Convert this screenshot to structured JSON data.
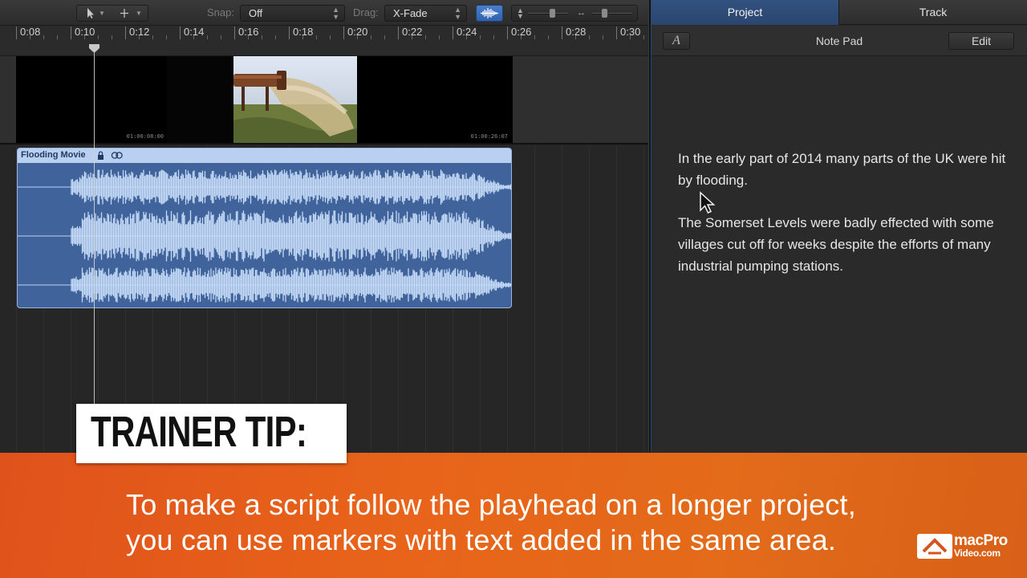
{
  "toolbar": {
    "snap_label": "Snap:",
    "snap_value": "Off",
    "drag_label": "Drag:",
    "drag_value": "X-Fade"
  },
  "ruler": {
    "ticks": [
      "0:08",
      "0:10",
      "0:12",
      "0:14",
      "0:16",
      "0:18",
      "0:20",
      "0:22",
      "0:24",
      "0:26",
      "0:28",
      "0:30"
    ]
  },
  "video_track": {
    "timecode_start": "01:00:08:00",
    "timecode_end": "01:00:26:07"
  },
  "audio_region": {
    "name": "Flooding Movie"
  },
  "right_panel": {
    "tabs": [
      {
        "label": "Project",
        "active": true
      },
      {
        "label": "Track",
        "active": false
      }
    ],
    "font_button": "A",
    "notepad_title": "Note Pad",
    "edit_button": "Edit",
    "paragraphs": [
      "In the early part of 2014 many parts of the UK were hit by flooding.",
      "The Somerset Levels were badly effected with some villages cut off for weeks despite the efforts of many industrial pumping stations."
    ]
  },
  "overlay": {
    "tip_label": "TRAINER TIP:",
    "lines": [
      "To make a script follow the playhead on a longer project,",
      "you can use markers with text added in the same area."
    ],
    "logo_line1": "macPro",
    "logo_line2": "Video.com"
  },
  "colors": {
    "accent_blue": "#3f639a",
    "region_header": "#bad0f0",
    "banner_orange": "#e36b1a"
  }
}
